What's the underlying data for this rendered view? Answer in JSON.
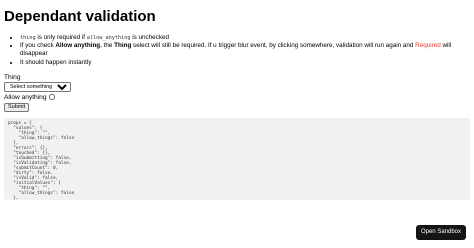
{
  "page": {
    "title": "Dependant validation",
    "bullets": {
      "b1": {
        "code1": "thing",
        "text1": " is only required if ",
        "code2": "allow_anything",
        "text2": " is unchecked"
      },
      "b2": {
        "text1": "If you check ",
        "strong1": "Allow anything",
        "text2": ", the ",
        "strong2": "Thing",
        "text3": " select will still be required. If u trigger blur event, by clicking somewhere, validation will run again and ",
        "required": "Required",
        "text4": " will disappear"
      },
      "b3": "It should happen instantly"
    }
  },
  "form": {
    "thing_label": "Thing",
    "select_value": "Select something",
    "allow_label": "Allow anything",
    "allow_checked": false,
    "submit_label": "Submit"
  },
  "state_dump": "props = {\n  \"values\": {\n    \"thing\": \"\",\n    \"allow_things\": false\n  },\n  \"errors\": {},\n  \"touched\": {},\n  \"isSubmitting\": false,\n  \"isValidating\": false,\n  \"submitCount\": 0,\n  \"dirty\": false,\n  \"isValid\": false,\n  \"initialValues\": {\n    \"thing\": \"\",\n    \"allow_things\": false\n  },\n  \"validateOnChange\": true,\n  \"validateOnBlur\": true\n}",
  "sandbox": {
    "label": "Open Sandbox"
  },
  "colors": {
    "required": "#e53935",
    "sandbox_bg": "#151515",
    "pre_bg": "#f1f1f1"
  }
}
